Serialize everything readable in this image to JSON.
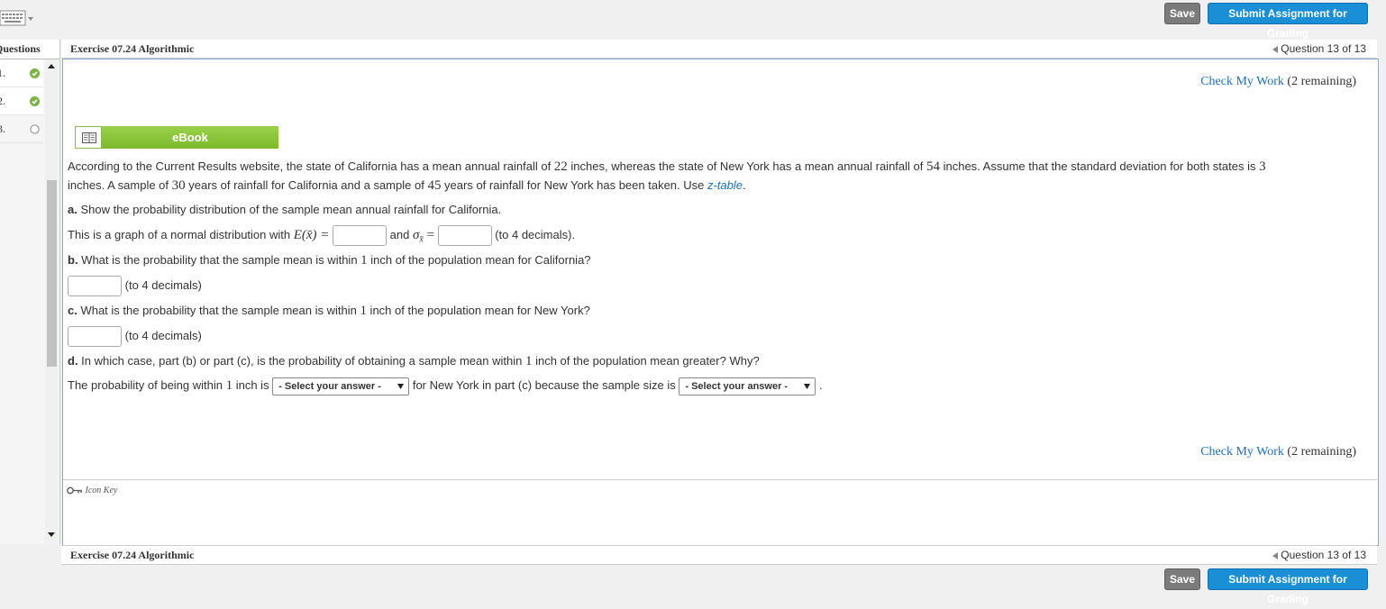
{
  "toolbar": {
    "save_label": "Save",
    "submit_label": "Submit Assignment for Grading"
  },
  "sidebar": {
    "header": "Questions",
    "items": [
      {
        "label": "1.",
        "status": "complete"
      },
      {
        "label": "2.",
        "status": "complete"
      },
      {
        "label": "3.",
        "status": "incomplete"
      }
    ]
  },
  "header": {
    "exercise_title": "Exercise 07.24 Algorithmic",
    "question_counter": "Question 13 of 13"
  },
  "check_work": {
    "link_label": "Check My Work",
    "remaining": "(2 remaining)"
  },
  "ebook_label": "eBook",
  "problem": {
    "intro_1": "According to the Current Results website, the state of California has a mean annual rainfall of ",
    "ca_rainfall": "22",
    "intro_2": " inches, whereas the state of New York has a mean annual rainfall of ",
    "ny_rainfall": "54",
    "intro_3": " inches. Assume that the standard deviation for both states is ",
    "std_dev": "3",
    "intro_4": "inches. A sample of ",
    "ca_sample": "30",
    "intro_5": " years of rainfall for California and a sample of ",
    "ny_sample": "45",
    "intro_6": " years of rainfall for New York has been taken. Use ",
    "ztable_link": "z-table",
    "intro_7": "."
  },
  "part_a": {
    "label": "a.",
    "question": " Show the probability distribution of the sample mean annual rainfall for California.",
    "line_prefix": "This is a graph of a normal distribution with ",
    "expectation": "E(x̄) =",
    "and_text": "and",
    "sigma": "σ",
    "sigma_sub": "x̄",
    "equals": "=",
    "decimals_note": "(to 4 decimals)."
  },
  "part_b": {
    "label": "b.",
    "question_1": " What is the probability that the sample mean is within ",
    "value": "1",
    "question_2": " inch of the population mean for California?",
    "decimals_note": "(to 4 decimals)"
  },
  "part_c": {
    "label": "c.",
    "question_1": " What is the probability that the sample mean is within ",
    "value": "1",
    "question_2": " inch of the population mean for New York?",
    "decimals_note": "(to 4 decimals)"
  },
  "part_d": {
    "label": "d.",
    "question_1": " In which case, part (b) or part (c), is the probability of obtaining a sample mean within ",
    "value": "1",
    "question_2": " inch of the population mean greater? Why?",
    "answer_1": "The probability of being within ",
    "answer_value": "1",
    "answer_2": " inch is",
    "select_1": "- Select your answer -",
    "answer_3": "for New York in part (c) because the sample size is",
    "select_2": "- Select your answer -",
    "answer_end": "."
  },
  "icon_key_label": "Icon Key",
  "colors": {
    "accent_blue": "#1a8fd6",
    "ebook_green": "#7dbb2e",
    "check_green": "#7cb342",
    "link_blue": "#1a6fc0"
  }
}
